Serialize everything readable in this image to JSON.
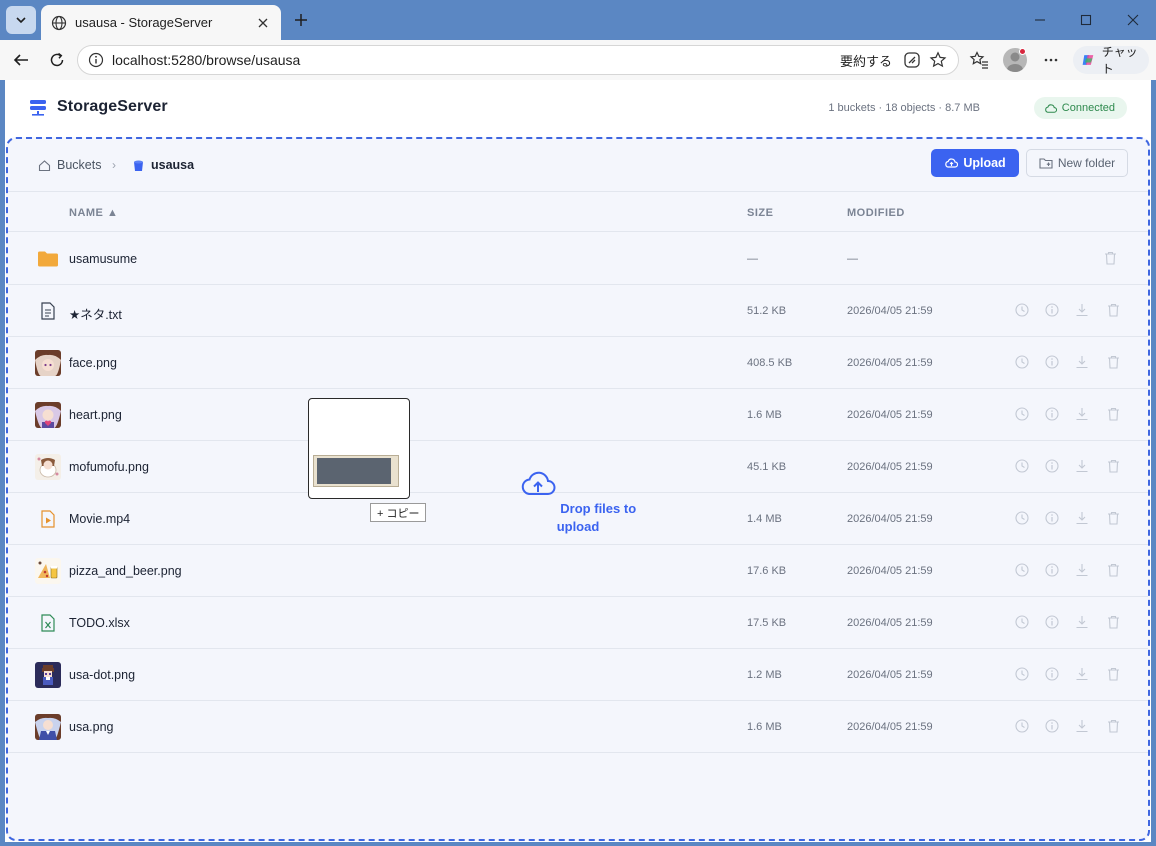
{
  "browser": {
    "tab_title": "usausa - StorageServer",
    "url": "localhost:5280/browse/usausa",
    "summarize_label": "要約する",
    "chat_label": "チャット"
  },
  "app": {
    "brand": "StorageServer",
    "stats": "1 buckets · 18 objects · 8.7 MB",
    "status": "Connected",
    "accent_color": "#3b63f0",
    "status_color": "#2f8a4e"
  },
  "breadcrumb": {
    "root": "Buckets",
    "current": "usausa"
  },
  "actions": {
    "upload": "Upload",
    "new_folder": "New folder"
  },
  "table": {
    "col_name": "NAME ▲",
    "col_size": "SIZE",
    "col_modified": "MODIFIED",
    "rows": [
      {
        "name": "usamusume",
        "size": "—",
        "modified": "—",
        "icon": "folder-icon"
      },
      {
        "name": "★ネタ.txt",
        "size": "51.2 KB",
        "modified": "2026/04/05 21:59",
        "icon": "text-file-icon"
      },
      {
        "name": "face.png",
        "size": "408.5 KB",
        "modified": "2026/04/05 21:59",
        "icon": "image-thumbnail"
      },
      {
        "name": "heart.png",
        "size": "1.6 MB",
        "modified": "2026/04/05 21:59",
        "icon": "image-thumbnail"
      },
      {
        "name": "mofumofu.png",
        "size": "45.1 KB",
        "modified": "2026/04/05 21:59",
        "icon": "image-thumbnail"
      },
      {
        "name": "Movie.mp4",
        "size": "1.4 MB",
        "modified": "2026/04/05 21:59",
        "icon": "video-file-icon"
      },
      {
        "name": "pizza_and_beer.png",
        "size": "17.6 KB",
        "modified": "2026/04/05 21:59",
        "icon": "image-thumbnail"
      },
      {
        "name": "TODO.xlsx",
        "size": "17.5 KB",
        "modified": "2026/04/05 21:59",
        "icon": "spreadsheet-file-icon"
      },
      {
        "name": "usa-dot.png",
        "size": "1.2 MB",
        "modified": "2026/04/05 21:59",
        "icon": "image-thumbnail"
      },
      {
        "name": "usa.png",
        "size": "1.6 MB",
        "modified": "2026/04/05 21:59",
        "icon": "image-thumbnail"
      }
    ]
  },
  "drop_hint": "Drop files to upload",
  "drag_badge": "+ コピー"
}
